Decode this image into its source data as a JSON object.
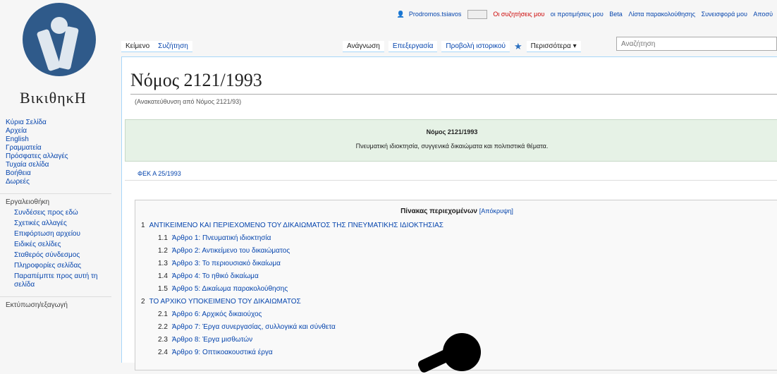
{
  "logo": {
    "text": "ΒικιθηκΗ"
  },
  "personal": {
    "user": "Prodromos.tsiavos",
    "notifications": "Οι συζητήσεις μου",
    "links": [
      "οι προτιμήσεις μου",
      "Beta",
      "Λίστα παρακολούθησης",
      "Συνεισφορά μου",
      "Αποσύ"
    ]
  },
  "tabs": {
    "left": [
      "Κείμενο",
      "Συζήτηση"
    ],
    "right": [
      "Ανάγνωση",
      "Επεξεργασία",
      "Προβολή ιστορικού"
    ],
    "more": "Περισσότερα ▾",
    "search_placeholder": "Αναζήτηση"
  },
  "sidebar": {
    "nav": [
      "Κύρια Σελίδα",
      "Αρχεία",
      "English",
      "Γραμματεία",
      "Πρόσφατες αλλαγές",
      "Τυχαία σελίδα",
      "Βοήθεια",
      "Δωρεές"
    ],
    "tools_head": "Εργαλειοθήκη",
    "tools": [
      "Συνδέσεις προς εδώ",
      "Σχετικές αλλαγές",
      "Επιφόρτωση αρχείου",
      "Ειδικές σελίδες",
      "Σταθερός σύνδεσμος",
      "Πληροφορίες σελίδας",
      "Παραπέμπτε προς αυτή τη σελίδα"
    ],
    "print_head": "Εκτύπωση/εξαγωγή"
  },
  "page": {
    "title": "Νόμος 2121/1993",
    "redirect": "(Ανακατεύθυνση από Νόμος 2121/93)",
    "header_title": "Νόμος 2121/1993",
    "header_subtitle": "Πνευματική ιδιοκτησία, συγγενικά δικαιώματα και πολιτιστικά θέματα.",
    "fek": "ΦΕΚ Α 25/1993"
  },
  "toc": {
    "title": "Πίνακας περιεχομένων",
    "hide": "[Απόκρυψη]",
    "items": [
      {
        "num": "1",
        "text": "ΑΝΤΙΚΕΙΜΕΝΟ ΚΑΙ ΠΕΡΙΕΧΟΜΕΝΟ ΤΟΥ ΔΙΚΑΙΩΜΑΤΟΣ ΤΗΣ ΠΝΕΥΜΑΤΙΚΗΣ ΙΔΙΟΚΤΗΣΙΑΣ",
        "level": 1
      },
      {
        "num": "1.1",
        "text": "Άρθρο 1: Πνευματική ιδιοκτησία",
        "level": 2
      },
      {
        "num": "1.2",
        "text": "Άρθρο 2: Αντικείμενο του δικαιώματος",
        "level": 2
      },
      {
        "num": "1.3",
        "text": "Άρθρο 3: Το περιουσιακό δικαίωμα",
        "level": 2
      },
      {
        "num": "1.4",
        "text": "Άρθρο 4: Το ηθικό δικαίωμα",
        "level": 2
      },
      {
        "num": "1.5",
        "text": "Άρθρο 5: Δικαίωμα παρακολούθησης",
        "level": 2
      },
      {
        "num": "2",
        "text": "ΤΟ ΑΡΧΙΚΟ ΥΠΟΚΕΙΜΕΝΟ ΤΟΥ ΔΙΚΑΙΩΜΑΤΟΣ",
        "level": 1
      },
      {
        "num": "2.1",
        "text": "Άρθρο 6: Αρχικός δικαιούχος",
        "level": 2
      },
      {
        "num": "2.2",
        "text": "Άρθρο 7: Έργα συνεργασίας, συλλογικά και σύνθετα",
        "level": 2
      },
      {
        "num": "2.3",
        "text": "Άρθρο 8: Έργα μισθωτών",
        "level": 2
      },
      {
        "num": "2.4",
        "text": "Άρθρο 9: Οπτικοακουστικά έργα",
        "level": 2
      }
    ]
  }
}
